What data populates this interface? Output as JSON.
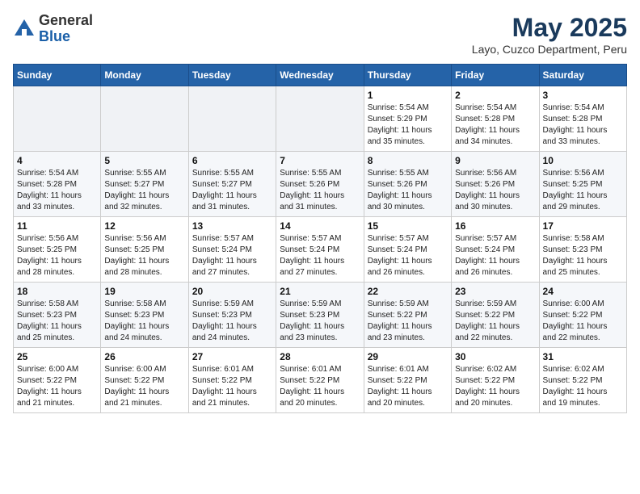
{
  "header": {
    "logo_general": "General",
    "logo_blue": "Blue",
    "title": "May 2025",
    "subtitle": "Layo, Cuzco Department, Peru"
  },
  "weekdays": [
    "Sunday",
    "Monday",
    "Tuesday",
    "Wednesday",
    "Thursday",
    "Friday",
    "Saturday"
  ],
  "weeks": [
    [
      {
        "num": "",
        "info": ""
      },
      {
        "num": "",
        "info": ""
      },
      {
        "num": "",
        "info": ""
      },
      {
        "num": "",
        "info": ""
      },
      {
        "num": "1",
        "info": "Sunrise: 5:54 AM\nSunset: 5:29 PM\nDaylight: 11 hours\nand 35 minutes."
      },
      {
        "num": "2",
        "info": "Sunrise: 5:54 AM\nSunset: 5:28 PM\nDaylight: 11 hours\nand 34 minutes."
      },
      {
        "num": "3",
        "info": "Sunrise: 5:54 AM\nSunset: 5:28 PM\nDaylight: 11 hours\nand 33 minutes."
      }
    ],
    [
      {
        "num": "4",
        "info": "Sunrise: 5:54 AM\nSunset: 5:28 PM\nDaylight: 11 hours\nand 33 minutes."
      },
      {
        "num": "5",
        "info": "Sunrise: 5:55 AM\nSunset: 5:27 PM\nDaylight: 11 hours\nand 32 minutes."
      },
      {
        "num": "6",
        "info": "Sunrise: 5:55 AM\nSunset: 5:27 PM\nDaylight: 11 hours\nand 31 minutes."
      },
      {
        "num": "7",
        "info": "Sunrise: 5:55 AM\nSunset: 5:26 PM\nDaylight: 11 hours\nand 31 minutes."
      },
      {
        "num": "8",
        "info": "Sunrise: 5:55 AM\nSunset: 5:26 PM\nDaylight: 11 hours\nand 30 minutes."
      },
      {
        "num": "9",
        "info": "Sunrise: 5:56 AM\nSunset: 5:26 PM\nDaylight: 11 hours\nand 30 minutes."
      },
      {
        "num": "10",
        "info": "Sunrise: 5:56 AM\nSunset: 5:25 PM\nDaylight: 11 hours\nand 29 minutes."
      }
    ],
    [
      {
        "num": "11",
        "info": "Sunrise: 5:56 AM\nSunset: 5:25 PM\nDaylight: 11 hours\nand 28 minutes."
      },
      {
        "num": "12",
        "info": "Sunrise: 5:56 AM\nSunset: 5:25 PM\nDaylight: 11 hours\nand 28 minutes."
      },
      {
        "num": "13",
        "info": "Sunrise: 5:57 AM\nSunset: 5:24 PM\nDaylight: 11 hours\nand 27 minutes."
      },
      {
        "num": "14",
        "info": "Sunrise: 5:57 AM\nSunset: 5:24 PM\nDaylight: 11 hours\nand 27 minutes."
      },
      {
        "num": "15",
        "info": "Sunrise: 5:57 AM\nSunset: 5:24 PM\nDaylight: 11 hours\nand 26 minutes."
      },
      {
        "num": "16",
        "info": "Sunrise: 5:57 AM\nSunset: 5:24 PM\nDaylight: 11 hours\nand 26 minutes."
      },
      {
        "num": "17",
        "info": "Sunrise: 5:58 AM\nSunset: 5:23 PM\nDaylight: 11 hours\nand 25 minutes."
      }
    ],
    [
      {
        "num": "18",
        "info": "Sunrise: 5:58 AM\nSunset: 5:23 PM\nDaylight: 11 hours\nand 25 minutes."
      },
      {
        "num": "19",
        "info": "Sunrise: 5:58 AM\nSunset: 5:23 PM\nDaylight: 11 hours\nand 24 minutes."
      },
      {
        "num": "20",
        "info": "Sunrise: 5:59 AM\nSunset: 5:23 PM\nDaylight: 11 hours\nand 24 minutes."
      },
      {
        "num": "21",
        "info": "Sunrise: 5:59 AM\nSunset: 5:23 PM\nDaylight: 11 hours\nand 23 minutes."
      },
      {
        "num": "22",
        "info": "Sunrise: 5:59 AM\nSunset: 5:22 PM\nDaylight: 11 hours\nand 23 minutes."
      },
      {
        "num": "23",
        "info": "Sunrise: 5:59 AM\nSunset: 5:22 PM\nDaylight: 11 hours\nand 22 minutes."
      },
      {
        "num": "24",
        "info": "Sunrise: 6:00 AM\nSunset: 5:22 PM\nDaylight: 11 hours\nand 22 minutes."
      }
    ],
    [
      {
        "num": "25",
        "info": "Sunrise: 6:00 AM\nSunset: 5:22 PM\nDaylight: 11 hours\nand 21 minutes."
      },
      {
        "num": "26",
        "info": "Sunrise: 6:00 AM\nSunset: 5:22 PM\nDaylight: 11 hours\nand 21 minutes."
      },
      {
        "num": "27",
        "info": "Sunrise: 6:01 AM\nSunset: 5:22 PM\nDaylight: 11 hours\nand 21 minutes."
      },
      {
        "num": "28",
        "info": "Sunrise: 6:01 AM\nSunset: 5:22 PM\nDaylight: 11 hours\nand 20 minutes."
      },
      {
        "num": "29",
        "info": "Sunrise: 6:01 AM\nSunset: 5:22 PM\nDaylight: 11 hours\nand 20 minutes."
      },
      {
        "num": "30",
        "info": "Sunrise: 6:02 AM\nSunset: 5:22 PM\nDaylight: 11 hours\nand 20 minutes."
      },
      {
        "num": "31",
        "info": "Sunrise: 6:02 AM\nSunset: 5:22 PM\nDaylight: 11 hours\nand 19 minutes."
      }
    ]
  ]
}
